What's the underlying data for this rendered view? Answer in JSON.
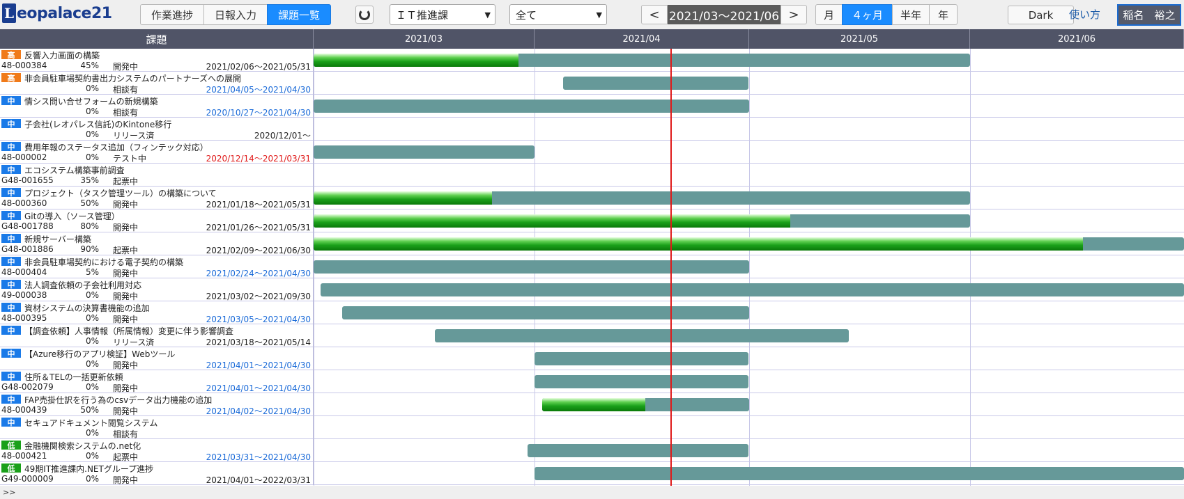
{
  "brand": {
    "logo_letter": "L",
    "logo_text": "eopalace21"
  },
  "nav_tabs": [
    {
      "label": "作業進捗",
      "active": false
    },
    {
      "label": "日報入力",
      "active": false
    },
    {
      "label": "課題一覧",
      "active": true
    }
  ],
  "reload_icon": "reload-icon",
  "department_select": {
    "value": "ＩＴ推進課"
  },
  "filter_select": {
    "value": "全て"
  },
  "period": {
    "prev": "<",
    "label": "2021/03～2021/06",
    "next": ">"
  },
  "span_tabs": [
    {
      "label": "月",
      "active": false
    },
    {
      "label": "４ヶ月",
      "active": true
    },
    {
      "label": "半年",
      "active": false
    },
    {
      "label": "年",
      "active": false
    }
  ],
  "dark_button": "Dark",
  "help_link": "使い方",
  "user_name": "稲名　裕之",
  "gantt": {
    "task_header": "課題",
    "months": [
      "2021/03",
      "2021/04",
      "2021/05",
      "2021/06"
    ],
    "today": "2021/04/20",
    "colors": {
      "bar": "#669999",
      "progress": "#1aa01a",
      "today_line": "#e01a1a",
      "priority_high": "#f07a1a",
      "priority_mid": "#1a7ae8",
      "priority_low": "#1aa01a"
    },
    "rows": [
      {
        "priority": "高",
        "level": "high",
        "title": "反響入力画面の構築",
        "code": "48-000384",
        "progress": "45%",
        "status": "開発中",
        "dates": "2021/02/06～2021/05/31",
        "date_color": "black",
        "start": "2021/02/06",
        "end": "2021/05/31",
        "pct": 45
      },
      {
        "priority": "高",
        "level": "high",
        "title": "非会員駐車場契約書出力システムのパートナーズへの展開",
        "code": "",
        "progress": "0%",
        "status": "相談有",
        "dates": "2021/04/05～2021/04/30",
        "date_color": "blue",
        "start": "2021/04/05",
        "end": "2021/04/30",
        "pct": 0
      },
      {
        "priority": "中",
        "level": "mid",
        "title": "情シス問い合せフォームの新規構築",
        "code": "",
        "progress": "0%",
        "status": "相談有",
        "dates": "2020/10/27～2021/04/30",
        "date_color": "blue",
        "start": "2020/10/27",
        "end": "2021/04/30",
        "pct": 0
      },
      {
        "priority": "中",
        "level": "mid",
        "title": "子会社(レオパレス信託)のKintone移行",
        "code": "",
        "progress": "0%",
        "status": "リリース済",
        "dates": "2020/12/01～",
        "date_color": "black",
        "start": "",
        "end": "",
        "pct": 0
      },
      {
        "priority": "中",
        "level": "mid",
        "title": "費用年報のステータス追加（フィンテック対応）",
        "code": "48-000002",
        "progress": "0%",
        "status": "テスト中",
        "dates": "2020/12/14～2021/03/31",
        "date_color": "red",
        "start": "2020/12/14",
        "end": "2021/03/31",
        "pct": 0
      },
      {
        "priority": "中",
        "level": "mid",
        "title": "エコシステム構築事前調査",
        "code": "G48-001655",
        "progress": "35%",
        "status": "起票中",
        "dates": "",
        "date_color": "black",
        "start": "",
        "end": "",
        "pct": 35
      },
      {
        "priority": "中",
        "level": "mid",
        "title": "プロジェクト（タスク管理ツール）の構築について",
        "code": "48-000360",
        "progress": "50%",
        "status": "開発中",
        "dates": "2021/01/18～2021/05/31",
        "date_color": "black",
        "start": "2021/01/18",
        "end": "2021/05/31",
        "pct": 50
      },
      {
        "priority": "中",
        "level": "mid",
        "title": "Gitの導入（ソース管理）",
        "code": "G48-001788",
        "progress": "80%",
        "status": "開発中",
        "dates": "2021/01/26～2021/05/31",
        "date_color": "black",
        "start": "2021/01/26",
        "end": "2021/05/31",
        "pct": 80
      },
      {
        "priority": "中",
        "level": "mid",
        "title": "新規サーバー構築",
        "code": "G48-001886",
        "progress": "90%",
        "status": "起票中",
        "dates": "2021/02/09～2021/06/30",
        "date_color": "black",
        "start": "2021/02/09",
        "end": "2021/06/30",
        "pct": 90
      },
      {
        "priority": "中",
        "level": "mid",
        "title": "非会員駐車場契約における電子契約の構築",
        "code": "48-000404",
        "progress": "5%",
        "status": "開発中",
        "dates": "2021/02/24～2021/04/30",
        "date_color": "blue",
        "start": "2021/02/24",
        "end": "2021/04/30",
        "pct": 5
      },
      {
        "priority": "中",
        "level": "mid",
        "title": "法人調査依頼の子会社利用対応",
        "code": "49-000038",
        "progress": "0%",
        "status": "開発中",
        "dates": "2021/03/02～2021/09/30",
        "date_color": "black",
        "start": "2021/03/02",
        "end": "2021/09/30",
        "pct": 0
      },
      {
        "priority": "中",
        "level": "mid",
        "title": "資材システムの決算書機能の追加",
        "code": "48-000395",
        "progress": "0%",
        "status": "開発中",
        "dates": "2021/03/05～2021/04/30",
        "date_color": "blue",
        "start": "2021/03/05",
        "end": "2021/04/30",
        "pct": 0
      },
      {
        "priority": "中",
        "level": "mid",
        "title": "【調査依頼】人事情報（所属情報）変更に伴う影響調査",
        "code": "",
        "progress": "0%",
        "status": "リリース済",
        "dates": "2021/03/18～2021/05/14",
        "date_color": "black",
        "start": "2021/03/18",
        "end": "2021/05/14",
        "pct": 0
      },
      {
        "priority": "中",
        "level": "mid",
        "title": "【Azure移行のアプリ検証】Webツール",
        "code": "",
        "progress": "0%",
        "status": "開発中",
        "dates": "2021/04/01～2021/04/30",
        "date_color": "blue",
        "start": "2021/04/01",
        "end": "2021/04/30",
        "pct": 0
      },
      {
        "priority": "中",
        "level": "mid",
        "title": "住所＆TELの一括更新依頼",
        "code": "G48-002079",
        "progress": "0%",
        "status": "開発中",
        "dates": "2021/04/01～2021/04/30",
        "date_color": "blue",
        "start": "2021/04/01",
        "end": "2021/04/30",
        "pct": 0
      },
      {
        "priority": "中",
        "level": "mid",
        "title": "FAP売掛仕訳を行う為のcsvデータ出力機能の追加",
        "code": "48-000439",
        "progress": "50%",
        "status": "開発中",
        "dates": "2021/04/02～2021/04/30",
        "date_color": "blue",
        "start": "2021/04/02",
        "end": "2021/04/30",
        "pct": 50
      },
      {
        "priority": "中",
        "level": "mid",
        "title": "セキュアドキュメント閲覧システム",
        "code": "",
        "progress": "0%",
        "status": "相談有",
        "dates": "",
        "date_color": "black",
        "start": "",
        "end": "",
        "pct": 0
      },
      {
        "priority": "低",
        "level": "low",
        "title": "金融機関検索システムの.net化",
        "code": "48-000421",
        "progress": "0%",
        "status": "起票中",
        "dates": "2021/03/31～2021/04/30",
        "date_color": "blue",
        "start": "2021/03/31",
        "end": "2021/04/30",
        "pct": 0
      },
      {
        "priority": "低",
        "level": "low",
        "title": "49期IT推進課内.NETグループ進捗",
        "code": "G49-000009",
        "progress": "0%",
        "status": "開発中",
        "dates": "2021/04/01～2022/03/31",
        "date_color": "black",
        "start": "2021/04/01",
        "end": "2022/03/31",
        "pct": 0
      }
    ]
  },
  "footer_label": ">>"
}
